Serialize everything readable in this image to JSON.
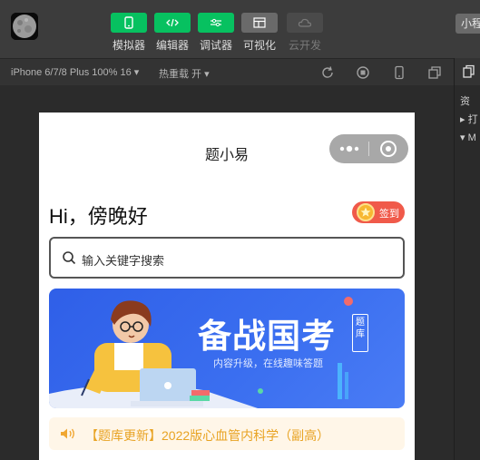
{
  "toolbar": {
    "tools": [
      {
        "label": "模拟器"
      },
      {
        "label": "编辑器"
      },
      {
        "label": "调试器"
      },
      {
        "label": "可视化"
      },
      {
        "label": "云开发"
      }
    ],
    "right_chip": "小程"
  },
  "subbar": {
    "device": "iPhone 6/7/8 Plus 100% 16 ▾",
    "hot_reload": "热重载 开 ▾"
  },
  "right_panel": {
    "rows": [
      "资",
      "▸ 打",
      "▾ M"
    ]
  },
  "simulator": {
    "nav_title": "题小易",
    "greeting": "Hi，傍晚好",
    "checkin_label": "签到",
    "search_placeholder": "输入关键字搜索",
    "banner": {
      "title": "备战国考",
      "tag": "题库",
      "subtitle": "内容升级，在线趣味答题"
    },
    "notice": "【题库更新】2022版心血管内科学（副高）"
  },
  "colors": {
    "accent_green": "#07c160",
    "banner_blue": "#3b6ff0",
    "checkin_red": "#f05a4a",
    "notice_orange": "#e8a323"
  }
}
